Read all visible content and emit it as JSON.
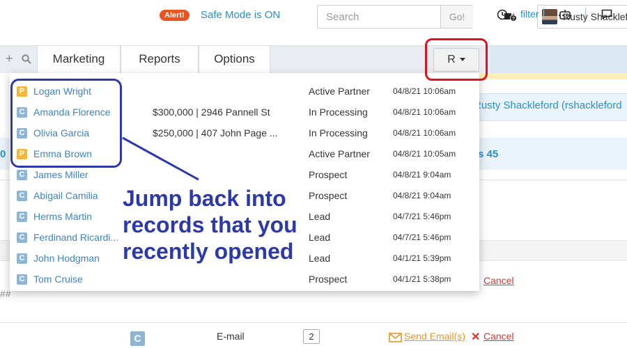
{
  "header": {
    "alert_badge": "Alert!",
    "safe_mode_text": "Safe Mode is ON",
    "search_placeholder": "Search",
    "search_button": "Go!",
    "user_name": "Rusty Shackleford",
    "icons": {
      "camera": "camera-help-icon"
    }
  },
  "nav": {
    "plus": "+",
    "tabs": [
      {
        "label": "Marketing"
      },
      {
        "label": "Reports"
      },
      {
        "label": "Options"
      }
    ],
    "recent_button": "R",
    "filter_label": "filter",
    "icons": {
      "search": "search-icon",
      "clock": "clock-icon",
      "robot": "robot-icon",
      "chat": "chat-icon"
    }
  },
  "background": {
    "user_row_text": "Rusty Shackleford (rshackleford",
    "left_fragment": "0",
    "count_fragment": "s 45",
    "hash_fragment": "##",
    "cancel_top": "Cancel",
    "bottom_row": {
      "badge": "C",
      "type": "E-mail",
      "count": "2",
      "send": "Send Email(s)",
      "x": "✕",
      "cancel": "Cancel"
    }
  },
  "recent_records": [
    {
      "type": "P",
      "name": "Logan Wright",
      "address": "",
      "status": "Active Partner",
      "time": "04/8/21 10:06am"
    },
    {
      "type": "C",
      "name": "Amanda Florence",
      "address": "$300,000 | 2946 Pannell St",
      "status": "In Processing",
      "time": "04/8/21 10:06am"
    },
    {
      "type": "C",
      "name": "Olivia Garcia",
      "address": "$250,000 | 407 John Page ...",
      "status": "In Processing",
      "time": "04/8/21 10:06am"
    },
    {
      "type": "P",
      "name": "Emma Brown",
      "address": "",
      "status": "Active Partner",
      "time": "04/8/21 10:05am"
    },
    {
      "type": "C",
      "name": "James Miller",
      "address": "",
      "status": "Prospect",
      "time": "04/8/21 9:04am"
    },
    {
      "type": "C",
      "name": "Abigail Camilia",
      "address": "",
      "status": "Prospect",
      "time": "04/8/21 9:04am"
    },
    {
      "type": "C",
      "name": "Herms Martin",
      "address": "",
      "status": "Lead",
      "time": "04/7/21 5:46pm"
    },
    {
      "type": "C",
      "name": "Ferdinand Ricardi...",
      "address": "",
      "status": "Lead",
      "time": "04/7/21 5:46pm"
    },
    {
      "type": "C",
      "name": "John Hodgman",
      "address": "",
      "status": "Lead",
      "time": "04/1/21 5:39pm"
    },
    {
      "type": "C",
      "name": "Tom Cruise",
      "address": "",
      "status": "Prospect",
      "time": "04/1/21 5:38pm"
    }
  ],
  "annotation": {
    "callout": "Jump back into records that you recently opened",
    "colors": {
      "red": "#e3101e",
      "blue": "#2b3aa8"
    }
  }
}
